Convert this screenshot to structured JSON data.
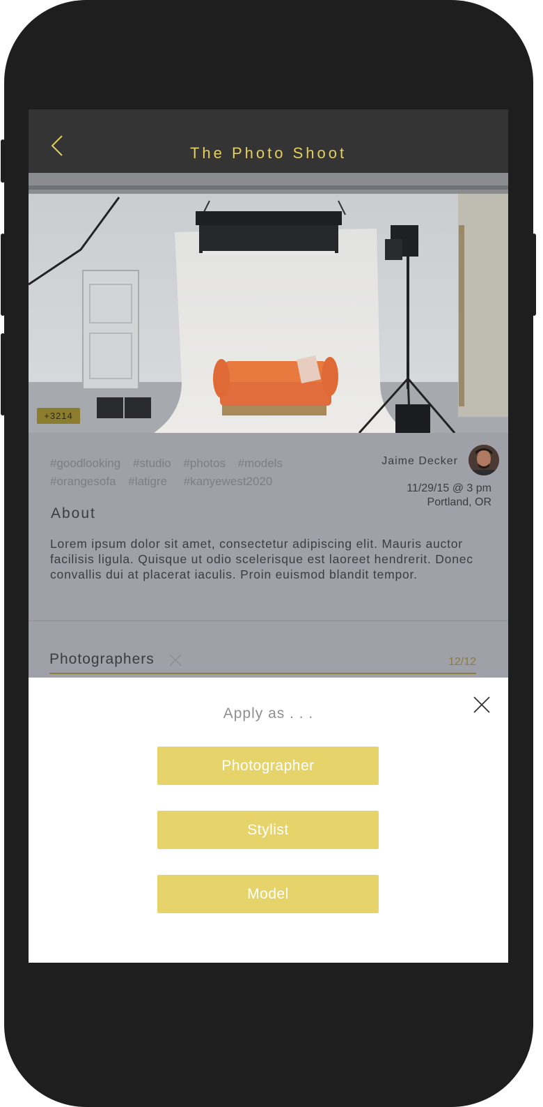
{
  "colors": {
    "accent": "#e6d46a",
    "title_yellow": "#e3cf5d",
    "navbar": "#343434",
    "overlay": "#a0a0a8",
    "phone_body": "#1e1e1e"
  },
  "header": {
    "back_icon": "chevron-left-icon",
    "title": "The Photo Shoot"
  },
  "hero": {
    "image": "photo-studio-orange-sofa",
    "badge": "+3214"
  },
  "event": {
    "tags": [
      "#goodlooking",
      "#studio",
      "#photos",
      "#models",
      "#orangesofa",
      "#latigre",
      "#kanyewest2020"
    ],
    "host_name": "Jaime Decker",
    "date": "11/29/15 @ 3 pm",
    "location": "Portland, OR",
    "about_heading": "About",
    "about_text": "Lorem ipsum dolor sit amet, consectetur adipiscing elit. Mauris auctor facilisis ligula. Quisque ut odio scelerisque est laoreet hendrerit. Donec convallis dui at placerat iaculis. Proin euismod blandit tempor."
  },
  "section": {
    "title": "Photographers",
    "count": "12/12"
  },
  "sheet": {
    "title": "Apply as . . .",
    "close_icon": "close-icon",
    "options": [
      "Photographer",
      "Stylist",
      "Model"
    ]
  }
}
